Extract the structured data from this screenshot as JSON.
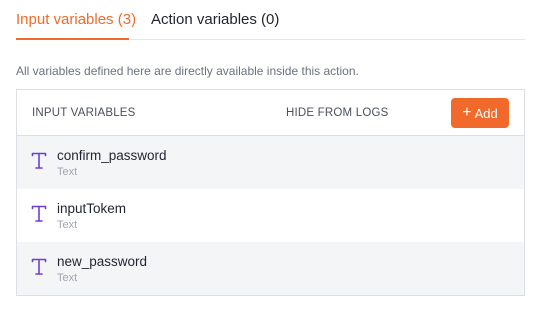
{
  "tabs": [
    {
      "label": "Input variables (3)",
      "active": true
    },
    {
      "label": "Action variables (0)",
      "active": false
    }
  ],
  "description": "All variables defined here are directly available inside this action.",
  "table": {
    "headers": {
      "name": "INPUT VARIABLES",
      "hide": "HIDE FROM LOGS"
    },
    "add_button": {
      "icon": "+",
      "label": "Add"
    },
    "rows": [
      {
        "icon": "text-type-icon",
        "name": "confirm_password",
        "type": "Text"
      },
      {
        "icon": "text-type-icon",
        "name": "inputTokem",
        "type": "Text"
      },
      {
        "icon": "text-type-icon",
        "name": "new_password",
        "type": "Text"
      }
    ]
  },
  "colors": {
    "accent": "#f26a2b",
    "icon": "#6c3fd6"
  }
}
